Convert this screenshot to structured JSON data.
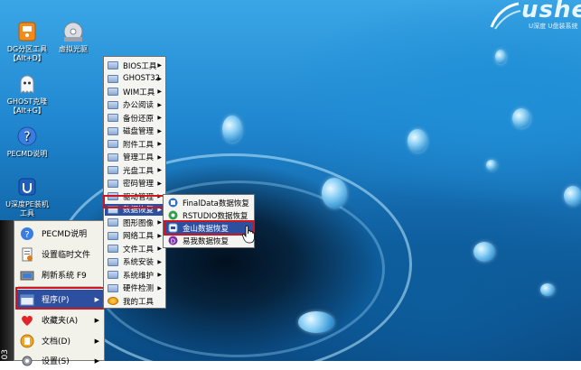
{
  "desktop": {
    "logo": {
      "brand": "usher",
      "subtitle": "U深度 U盘装系统"
    },
    "icons": [
      {
        "label_line1": "DG分区工具",
        "label_line2": "【Alt+D】",
        "icon": "partition-tool-icon"
      },
      {
        "label_line1": "虚拟光驱",
        "label_line2": "",
        "icon": "virtual-drive-icon"
      },
      {
        "label_line1": "GHOST克隆",
        "label_line2": "【Alt+G】",
        "icon": "ghost-icon"
      },
      {
        "label_line1": "PECMD说明",
        "label_line2": "",
        "icon": "help-icon"
      },
      {
        "label_line1": "U深度PE装机",
        "label_line2": "工具",
        "icon": "installer-icon"
      }
    ]
  },
  "start_menu": {
    "sidebar_text": "03",
    "items": [
      {
        "label": "PECMD说明",
        "icon": "help-icon",
        "arrow": ""
      },
      {
        "label": "设置临时文件",
        "icon": "temp-file-icon",
        "arrow": ""
      },
      {
        "label": "刷新系统 F9",
        "icon": "refresh-icon",
        "arrow": ""
      },
      {
        "label": "程序(P)",
        "icon": "programs-icon",
        "arrow": "▶"
      },
      {
        "label": "收藏夹(A)",
        "icon": "favorites-icon",
        "arrow": "▶"
      },
      {
        "label": "文档(D)",
        "icon": "documents-icon",
        "arrow": "▶"
      },
      {
        "label": "设置(S)",
        "icon": "settings-icon",
        "arrow": "▶"
      }
    ]
  },
  "programs_menu": {
    "items": [
      {
        "label": "BIOS工具",
        "arrow": "▶"
      },
      {
        "label": "GHOST32",
        "arrow": "▶"
      },
      {
        "label": "WIM工具",
        "arrow": "▶"
      },
      {
        "label": "办公阅读",
        "arrow": "▶"
      },
      {
        "label": "备份还原",
        "arrow": "▶"
      },
      {
        "label": "磁盘管理",
        "arrow": "▶"
      },
      {
        "label": "附件工具",
        "arrow": "▶"
      },
      {
        "label": "管理工具",
        "arrow": "▶"
      },
      {
        "label": "光盘工具",
        "arrow": "▶"
      },
      {
        "label": "密码管理",
        "arrow": "▶"
      },
      {
        "label": "驱动管理",
        "arrow": "▶"
      },
      {
        "label": "数据恢复",
        "arrow": "▶"
      },
      {
        "label": "图形图像",
        "arrow": "▶"
      },
      {
        "label": "网络工具",
        "arrow": "▶"
      },
      {
        "label": "文件工具",
        "arrow": "▶"
      },
      {
        "label": "系统安装",
        "arrow": "▶"
      },
      {
        "label": "系统维护",
        "arrow": "▶"
      },
      {
        "label": "硬件检测",
        "arrow": "▶"
      },
      {
        "label": "我的工具",
        "arrow": ""
      }
    ]
  },
  "recovery_menu": {
    "items": [
      {
        "label": "FinalData数据恢复",
        "icon": "finaldata-icon"
      },
      {
        "label": "RSTUDIO数据恢复",
        "icon": "rstudio-icon"
      },
      {
        "label": "金山数据恢复",
        "icon": "kingsoft-recovery-icon"
      },
      {
        "label": "易我数据恢复",
        "icon": "easeus-icon"
      }
    ]
  },
  "colors": {
    "highlight": "#2d4fa0",
    "annotation": "#d2141e",
    "menu_bg": "#f4f4f0"
  }
}
